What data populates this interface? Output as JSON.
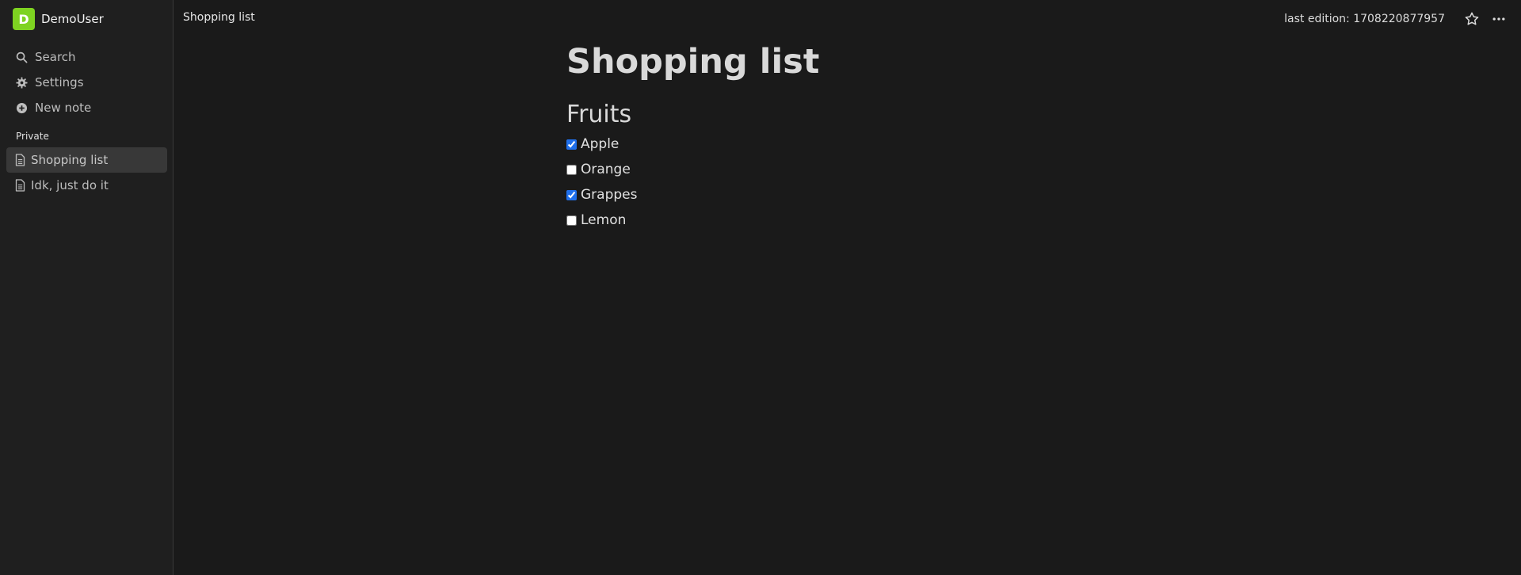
{
  "app": {
    "accent": "#7ed321"
  },
  "user": {
    "initial": "D",
    "name": "DemoUser",
    "avatar_color": "#7ed321"
  },
  "sidebar": {
    "nav": [
      {
        "label": "Search",
        "icon": "search-icon"
      },
      {
        "label": "Settings",
        "icon": "gear-icon"
      },
      {
        "label": "New note",
        "icon": "plus-circle-icon"
      }
    ],
    "section_label": "Private",
    "pages": [
      {
        "label": "Shopping list",
        "icon": "document-icon",
        "active": true
      },
      {
        "label": "Idk, just do it",
        "icon": "document-icon",
        "active": false
      }
    ]
  },
  "header": {
    "breadcrumb": "Shopping list",
    "last_edition": "last edition: 1708220877957",
    "star_icon": "star-icon",
    "more_icon": "more-horizontal-icon"
  },
  "document": {
    "title": "Shopping list",
    "heading": "Fruits",
    "items": [
      {
        "label": "Apple",
        "checked": true
      },
      {
        "label": "Orange",
        "checked": false
      },
      {
        "label": "Grappes",
        "checked": true
      },
      {
        "label": "Lemon",
        "checked": false
      }
    ]
  }
}
